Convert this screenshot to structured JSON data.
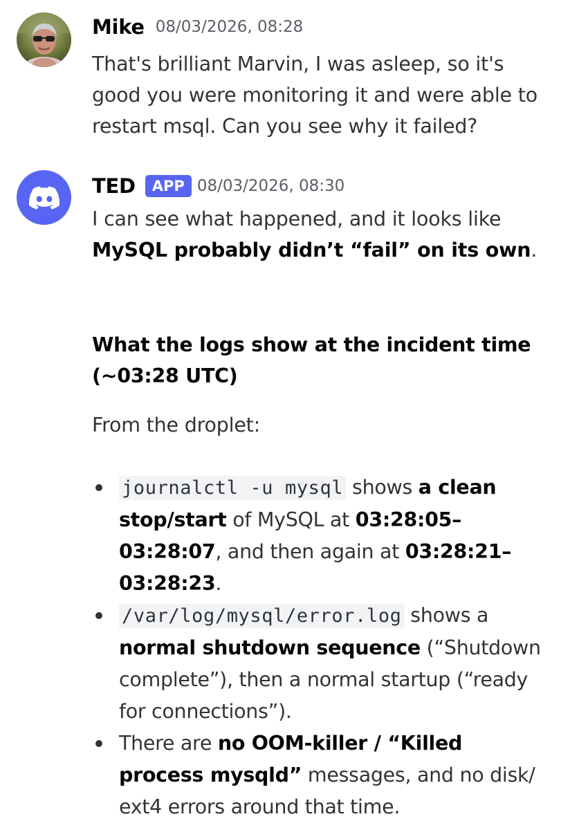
{
  "messages": [
    {
      "author": "Mike",
      "timestamp": "08/03/2026, 08:28",
      "text": "That's brilliant Marvin, I was asleep, so it's good you were monitoring it and were able to restart msql. Can you see why it failed?",
      "avatar_icon": "user-photo"
    },
    {
      "author": "TED",
      "badge": "APP",
      "timestamp": "08/03/2026, 08:30",
      "avatar_icon": "discord-logo-icon",
      "intro_plain": "I can see what happened, and it looks like ",
      "intro_bold": "MySQL probably didn’t “fail” on its own",
      "intro_end": ".",
      "heading": "What the logs show at the incident time (~03:28 UTC)",
      "from_line": "From the droplet:",
      "bullets": [
        {
          "code": "journalctl -u mysql",
          "t1": " shows ",
          "b1": "a clean stop/start",
          "t2": " of MySQL at ",
          "b2": "03:28:05–03:28:07",
          "t3": ", and then again at ",
          "b3": "03:28:21–03:28:23",
          "t4": "."
        },
        {
          "code": "/var/log/mysql/error.log",
          "t1": " shows a ",
          "b1": "normal shutdown sequence",
          "t2": " (“Shutdown complete”), then a normal startup (“ready for connections”)."
        },
        {
          "t1": "There are ",
          "b1": "no OOM-killer / “Killed process mysqld”",
          "t2": " messages, and no disk/ ext4 errors around that time."
        }
      ]
    }
  ],
  "colors": {
    "badge": "#5865f2",
    "text": "#313338",
    "muted": "#5c5e66",
    "code_bg": "#f2f3f5"
  }
}
